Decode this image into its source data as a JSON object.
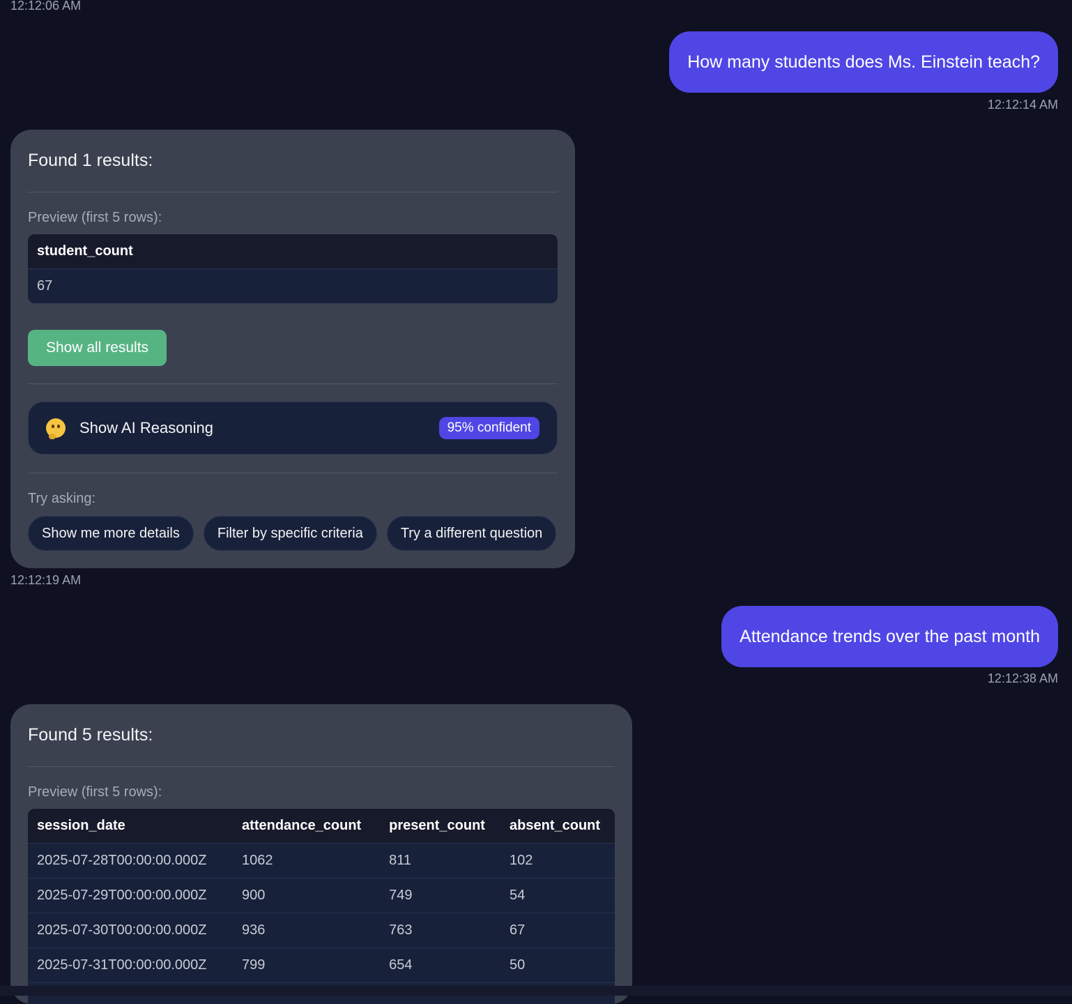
{
  "messages": {
    "ts0": "12:12:06 AM",
    "user1": {
      "text": "How many students does Ms. Einstein teach?",
      "time": "12:12:14 AM"
    },
    "bot1": {
      "found": "Found 1 results:",
      "preview": "Preview (first 5 rows):",
      "columns": [
        "student_count"
      ],
      "rows": [
        [
          "67"
        ]
      ],
      "show_all": "Show all results",
      "reasoning_label": "Show AI Reasoning",
      "reasoning_icon": "thinking-face-emoji",
      "confidence": "95% confident",
      "try_label": "Try asking:",
      "suggestions": [
        "Show me more details",
        "Filter by specific criteria",
        "Try a different question"
      ],
      "time": "12:12:19 AM"
    },
    "user2": {
      "text": "Attendance trends over the past month",
      "time": "12:12:38 AM"
    },
    "bot2": {
      "found": "Found 5 results:",
      "preview": "Preview (first 5 rows):",
      "columns": [
        "session_date",
        "attendance_count",
        "present_count",
        "absent_count"
      ],
      "rows": [
        [
          "2025-07-28T00:00:00.000Z",
          "1062",
          "811",
          "102"
        ],
        [
          "2025-07-29T00:00:00.000Z",
          "900",
          "749",
          "54"
        ],
        [
          "2025-07-30T00:00:00.000Z",
          "936",
          "763",
          "67"
        ],
        [
          "2025-07-31T00:00:00.000Z",
          "799",
          "654",
          "50"
        ]
      ]
    }
  },
  "colors": {
    "background": "#0f1123",
    "user_bubble": "#4f46e5",
    "bot_card": "#3c4150",
    "show_all_button": "#56b483",
    "confidence_badge": "#4f46e5"
  }
}
